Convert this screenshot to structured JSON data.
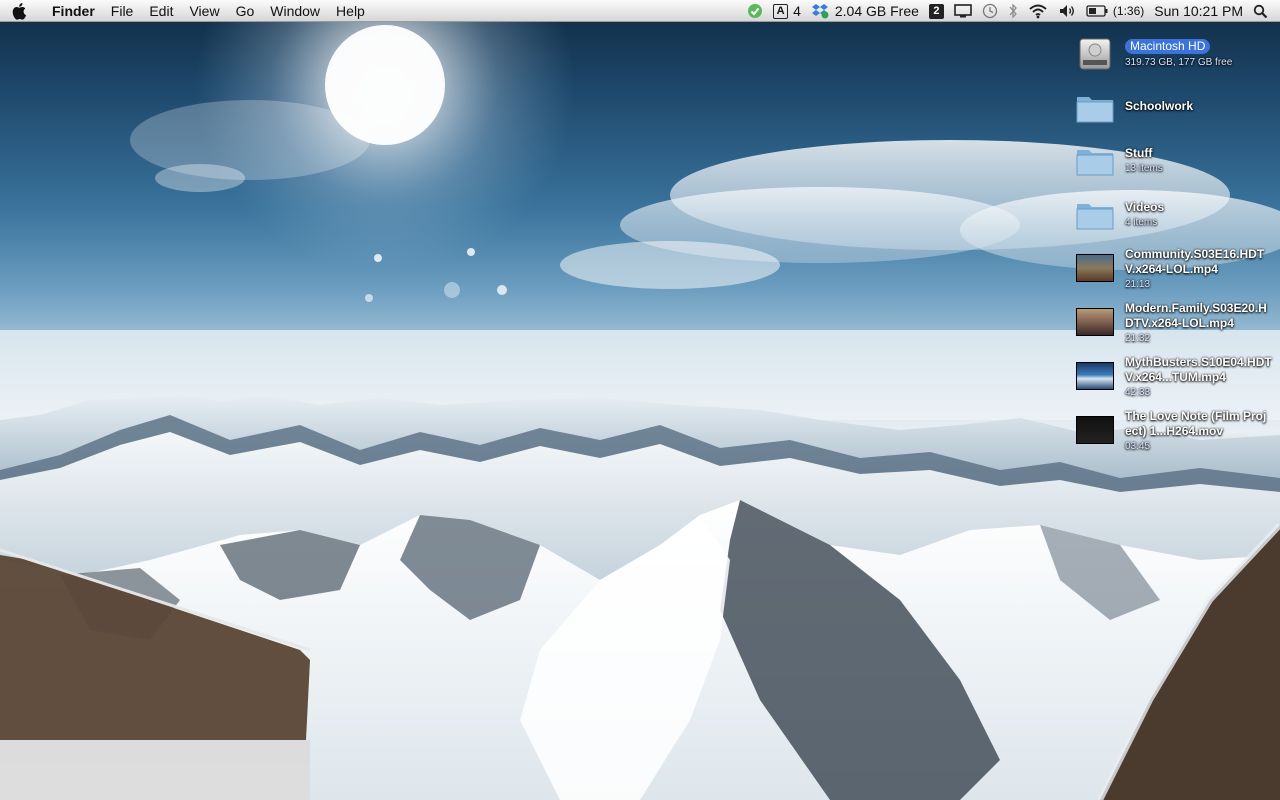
{
  "menubar": {
    "app_name": "Finder",
    "menus": [
      "File",
      "Edit",
      "View",
      "Go",
      "Window",
      "Help"
    ],
    "status": {
      "adobe_count": "4",
      "disk_free": "2.04 GB Free",
      "spaces_number": "2",
      "battery_time": "(1:36)",
      "clock": "Sun 10:21 PM"
    }
  },
  "desktop": {
    "items": [
      {
        "name": "Macintosh HD",
        "sub": "319.73 GB, 177 GB free",
        "kind": "hard-drive"
      },
      {
        "name": "Schoolwork",
        "sub": "",
        "kind": "folder"
      },
      {
        "name": "Stuff",
        "sub": "13 items",
        "kind": "folder"
      },
      {
        "name": "Videos",
        "sub": "4 items",
        "kind": "folder"
      },
      {
        "name": "Community.S03E16.HDTV.x264-LOL.mp4",
        "sub": "21:13",
        "kind": "video"
      },
      {
        "name": "Modern.Family.S03E20.HDTV.x264-LOL.mp4",
        "sub": "21:32",
        "kind": "video"
      },
      {
        "name": "MythBusters.S10E04.HDTV.x264...TUM.mp4",
        "sub": "42:33",
        "kind": "video"
      },
      {
        "name": "The Love Note (Film Project) 1...H264.mov",
        "sub": "03:45",
        "kind": "video-dark"
      }
    ]
  },
  "colors": {
    "selection": "#3b73d9",
    "menubar_top": "#fbfbfb",
    "menubar_bottom": "#d6d6d6"
  }
}
